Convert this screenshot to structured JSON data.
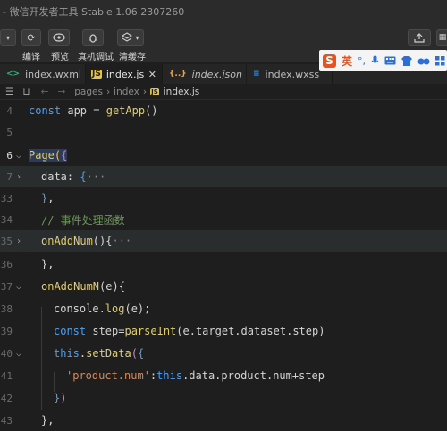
{
  "window": {
    "title": "- 微信开发者工具 Stable 1.06.2307260"
  },
  "toolbar": {
    "compile_label": "编译",
    "preview_label": "预览",
    "remote_debug_label": "真机调试",
    "clear_cache_label": "清缓存"
  },
  "ime": {
    "mode_label": "英",
    "punct": "°,"
  },
  "tabs": [
    {
      "label": "index.wxml",
      "icon": "wxml-file-icon",
      "active": false
    },
    {
      "label": "index.js",
      "icon": "js-file-icon",
      "active": true
    },
    {
      "label": "index.json",
      "icon": "json-file-icon",
      "active": false
    },
    {
      "label": "index.wxss",
      "icon": "wxss-file-icon",
      "active": false
    }
  ],
  "breadcrumb": {
    "items": [
      "pages",
      "index",
      "index.js"
    ]
  },
  "editor": {
    "lines": [
      {
        "n": "4",
        "text": "const app = getApp()"
      },
      {
        "n": "5",
        "text": ""
      },
      {
        "n": "6",
        "text": "Page({"
      },
      {
        "n": "7",
        "text": "data: {···"
      },
      {
        "n": "33",
        "text": "},"
      },
      {
        "n": "34",
        "text": "// 事件处理函数"
      },
      {
        "n": "35",
        "text": "onAddNum(){···"
      },
      {
        "n": "36",
        "text": "},"
      },
      {
        "n": "37",
        "text": "onAddNumN(e){"
      },
      {
        "n": "38",
        "text": "console.log(e);"
      },
      {
        "n": "39",
        "text": "const step=parseInt(e.target.dataset.step)"
      },
      {
        "n": "40",
        "text": "this.setData({"
      },
      {
        "n": "41",
        "text": "'product.num':this.data.product.num+step"
      },
      {
        "n": "42",
        "text": "})"
      },
      {
        "n": "43",
        "text": "},"
      }
    ]
  },
  "colors": {
    "keyword": "#4f9ff0",
    "function": "#e0cd6b",
    "string": "#cc8a64",
    "comment": "#6a9955",
    "background": "#1e1e1e"
  }
}
